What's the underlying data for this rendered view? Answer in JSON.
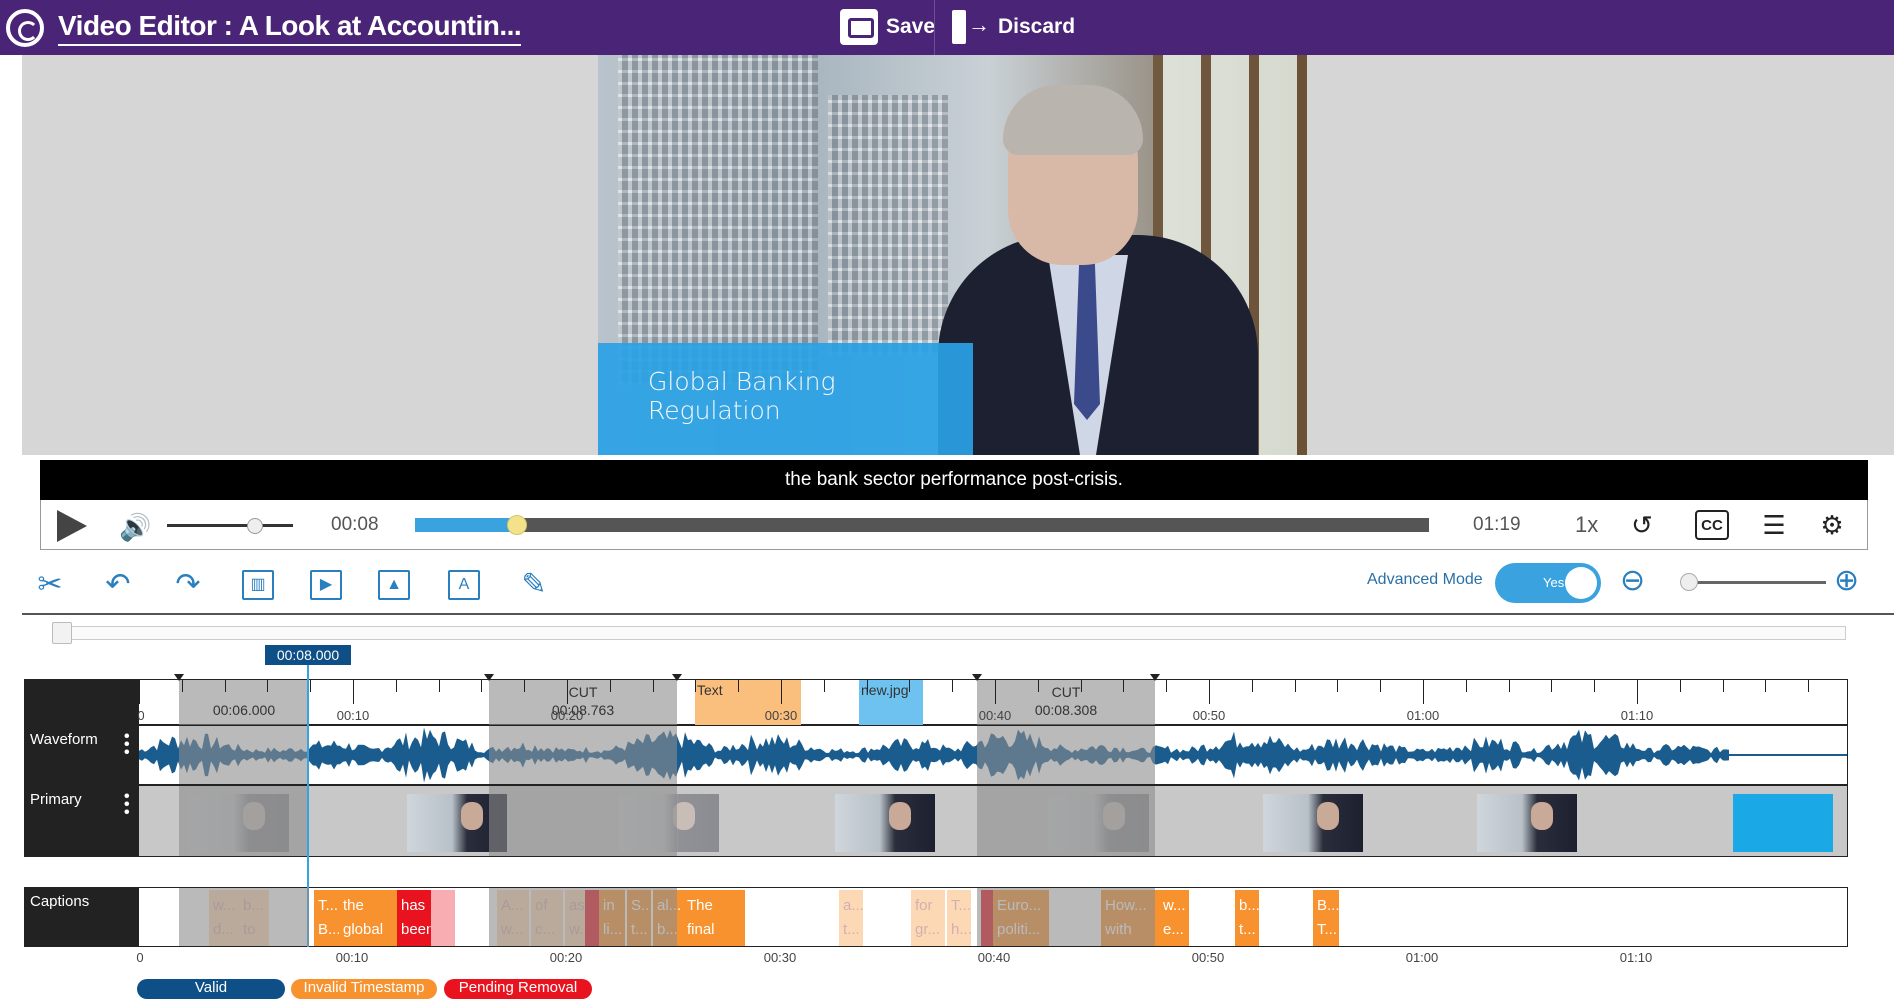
{
  "app": {
    "title": "Video Editor : A Look at Accountin...",
    "save_label": "Save",
    "discard_label": "Discard"
  },
  "video": {
    "lower_third": "Global Banking Regulation",
    "caption": "the bank sector performance post-crisis."
  },
  "player": {
    "current_time": "00:08",
    "total_time": "01:19",
    "speed": "1x",
    "progress": 0.101,
    "volume": 0.7
  },
  "toolbar": {
    "advanced_mode_label": "Advanced Mode",
    "advanced_mode_value": "Yes"
  },
  "timeline": {
    "playhead": "00:08.000",
    "ticks": [
      "0",
      "00:10",
      "00:20",
      "00:30",
      "00:40",
      "00:50",
      "01:00",
      "01:10"
    ],
    "cuts": [
      {
        "label": "",
        "duration": "00:06.000"
      },
      {
        "label": "CUT",
        "duration": "00:08.763"
      },
      {
        "label": "CUT",
        "duration": "00:08.308"
      }
    ],
    "overlays": [
      {
        "type": "text",
        "label": "Text"
      },
      {
        "type": "image",
        "label": "new.jpg"
      }
    ],
    "rows": {
      "waveform": "Waveform",
      "primary": "Primary",
      "captions": "Captions"
    },
    "captions": [
      {
        "l1": "w...",
        "l2": "d...",
        "color": "orange",
        "dim": true
      },
      {
        "l1": "b...",
        "l2": "to",
        "color": "orange",
        "dim": true
      },
      {
        "l1": "T...",
        "l2": "B...",
        "color": "orange",
        "dim": false
      },
      {
        "l1": "the",
        "l2": "global",
        "color": "orange",
        "dim": false
      },
      {
        "l1": "has",
        "l2": "been",
        "color": "red",
        "dim": false
      },
      {
        "l1": "",
        "l2": "",
        "color": "red",
        "dim": true
      },
      {
        "l1": "A...",
        "l2": "w...",
        "color": "orange",
        "dim": true
      },
      {
        "l1": "of",
        "l2": "c...",
        "color": "orange",
        "dim": true
      },
      {
        "l1": "as",
        "l2": "w...",
        "color": "orange",
        "dim": true
      },
      {
        "l1": "",
        "l2": "",
        "color": "red",
        "dim": false
      },
      {
        "l1": "in",
        "l2": "li...",
        "color": "orange",
        "dim": false
      },
      {
        "l1": "S...",
        "l2": "t...",
        "color": "orange",
        "dim": false
      },
      {
        "l1": "al...",
        "l2": "b...",
        "color": "orange",
        "dim": false
      },
      {
        "l1": "The",
        "l2": "final",
        "color": "orange",
        "dim": false
      },
      {
        "l1": "a...",
        "l2": "t...",
        "color": "orange",
        "dim": true
      },
      {
        "l1": "for",
        "l2": "gr...",
        "color": "orange",
        "dim": true
      },
      {
        "l1": "T...",
        "l2": "h...",
        "color": "orange",
        "dim": true
      },
      {
        "l1": "",
        "l2": "",
        "color": "red",
        "dim": false
      },
      {
        "l1": "Euro...",
        "l2": "politi...",
        "color": "orange",
        "dim": false
      },
      {
        "l1": "How...",
        "l2": "with",
        "color": "orange",
        "dim": false
      },
      {
        "l1": "w...",
        "l2": "e...",
        "color": "orange",
        "dim": false
      },
      {
        "l1": "b...",
        "l2": "t...",
        "color": "orange",
        "dim": false
      },
      {
        "l1": "B...",
        "l2": "T...",
        "color": "orange",
        "dim": false
      }
    ]
  },
  "legend": {
    "valid": "Valid",
    "invalid": "Invalid Timestamp",
    "pending": "Pending Removal"
  },
  "colors": {
    "topbar": "#4a2577",
    "accent": "#3aa3df",
    "valid": "#0d4f86",
    "invalid": "#f7922e",
    "pending": "#e8131f"
  }
}
